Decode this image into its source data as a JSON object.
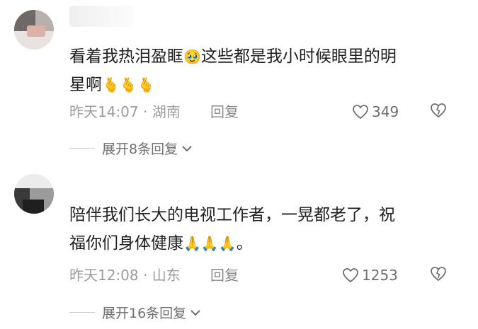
{
  "comments": [
    {
      "text_line1": "看着我热泪盈眶",
      "text_line1_after": "这些都是我小时候眼里的明",
      "text_line2": "星啊",
      "emoji1": "🥹",
      "emoji_trail": "🫰🫰🫰",
      "meta": "昨天14:07 · 湖南",
      "reply_label": "回复",
      "likes": "349",
      "expand_label": "展开8条回复"
    },
    {
      "text_line1": "陪伴我们长大的电视工作者，一晃都老了，祝",
      "text_line2": "福你们身体健康",
      "emoji_trail": "🙏🙏🙏",
      "text_end": "。",
      "meta": "昨天12:08 · 山东",
      "reply_label": "回复",
      "likes": "1253",
      "expand_label": "展开16条回复"
    }
  ],
  "icons": {
    "like": "heart-outline-icon",
    "dislike": "broken-heart-icon",
    "expand": "chevron-down-icon"
  },
  "colors": {
    "text": "#1f1f1f",
    "meta": "#9c9c9c",
    "action": "#6f6f6f"
  }
}
